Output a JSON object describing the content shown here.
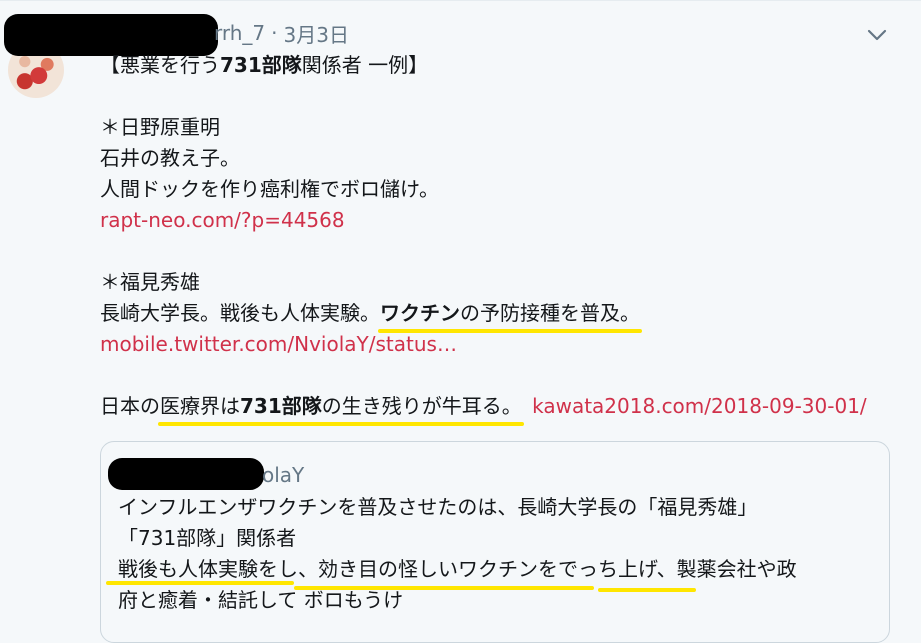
{
  "tweet": {
    "handle_suffix": "rrh_7",
    "sep": "·",
    "date": "3月3日",
    "heading_pre": "【悪業を行う",
    "heading_bold": "731部隊",
    "heading_post": "関係者 一例】",
    "p1_name": "＊日野原重明",
    "p1_l1": "石井の教え子。",
    "p1_l2": "人間ドックを作り癌利権でボロ儲け。",
    "p1_link": "rapt-neo.com/?p=44568",
    "p2_name": "＊福見秀雄",
    "p2_l1_a": "長崎大学長。戦後も人体実験。",
    "p2_l1_bold": "ワクチン",
    "p2_l1_b": "の予防接種を普及。",
    "p2_link": "mobile.twitter.com/NviolaY/status…",
    "last_a": "日本の",
    "last_hl": "医療界",
    "last_b": "は",
    "last_bold": "731部隊",
    "last_c": "の生き残りが牛耳る。",
    "last_link": "kawata2018.com/2018-09-30-01/"
  },
  "quoted": {
    "handle_suffix": "olaY",
    "l1": "インフルエンザワクチンを普及させたのは、長崎大学長の「福見秀雄」",
    "l2": "「731部隊」関係者",
    "l3": "戦後も人体実験をし、効き目の怪しいワクチンをでっち上げ、製薬会社や政",
    "l4": "府と癒着・結託して ボロもうけ"
  },
  "colors": {
    "link": "#d0314a",
    "highlight": "#ffe600",
    "muted": "#657786"
  },
  "icons": {
    "menu": "chevron-down-icon"
  }
}
